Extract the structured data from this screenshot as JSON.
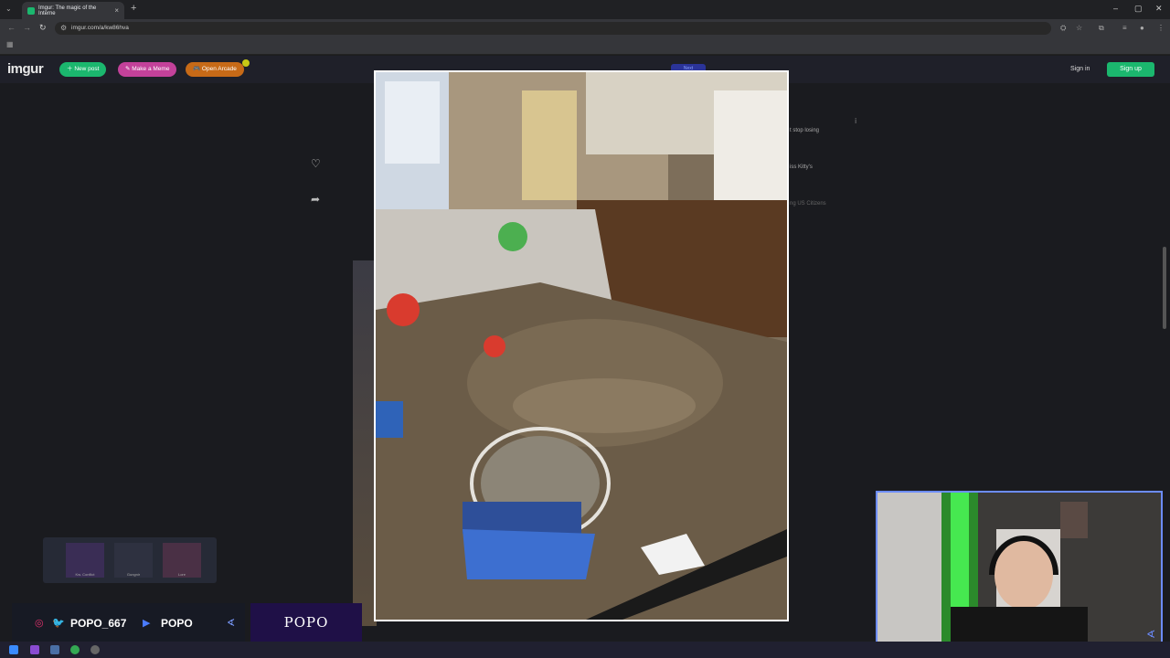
{
  "browser": {
    "tab_title": "Imgur: The magic of the Interne",
    "url": "imgur.com/a/kw86hva",
    "icons": {
      "tab_list": "chevron-down-icon",
      "new_tab": "+",
      "close_tab": "×",
      "minimize": "–",
      "restore": "▢",
      "close_window": "✕",
      "back": "←",
      "forward": "→",
      "reload": "↻"
    }
  },
  "imgur": {
    "logo": "imgur",
    "new_post": "New post",
    "make_meme": "Make a Meme",
    "open_arcade": "Open Arcade",
    "sign_in": "Sign in",
    "sign_up": "Sign up",
    "next_label": "Next",
    "side_titles": [
      "t stop losing",
      "iss Kitty's",
      "ng US Citizens"
    ],
    "colors": {
      "new_post": "#1bb76e",
      "make_meme": "#c3419a",
      "open_arcade": "#c76a17",
      "sign_up": "#1bb76e"
    }
  },
  "overlay": {
    "weapons": [
      "Kw. Conflict",
      "Gungnir",
      "Lore"
    ],
    "twitter_handle": "POPO_667",
    "youtube_handle": "POPO",
    "brand": "POPO"
  }
}
